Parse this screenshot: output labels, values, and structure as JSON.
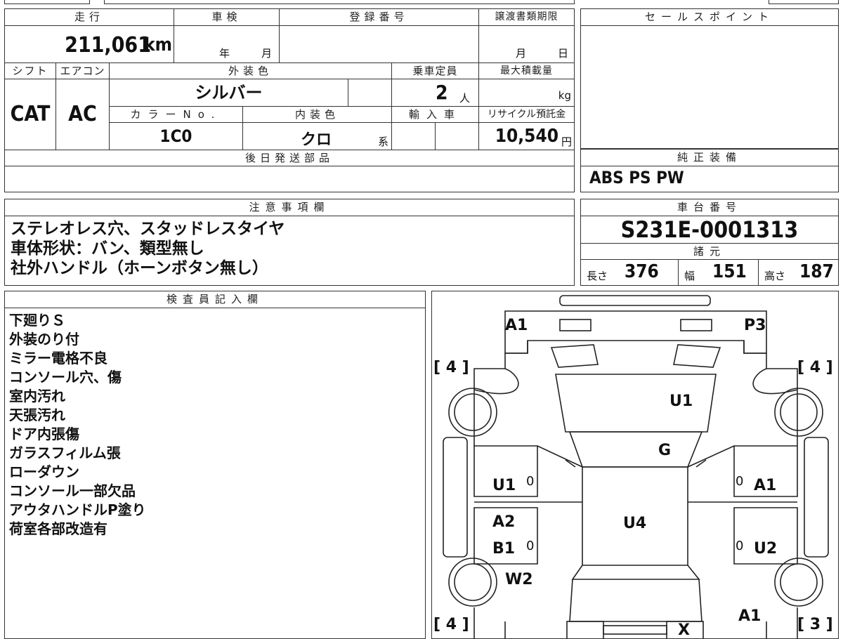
{
  "top_left": {
    "mileage_header": "走行",
    "mileage_value": "211,061",
    "mileage_unit": "km",
    "shaken_header": "車検",
    "shaken_year": "年",
    "shaken_month": "月",
    "reg_header": "登録番号",
    "transfer_header": "譲渡書類期限",
    "transfer_month": "月",
    "transfer_day": "日",
    "shift_header": "シフト",
    "aircon_header": "エアコン",
    "ext_color_header": "外装色",
    "capacity_header": "乗車定員",
    "max_load_header": "最大積載量",
    "shift_value": "CAT",
    "aircon_value": "AC",
    "ext_color_value": "シルバー",
    "capacity_value": "2",
    "capacity_unit": "人",
    "max_load_unit": "kg",
    "color_no_header": "カラーNo.",
    "int_color_header": "内装色",
    "import_header": "輸入車",
    "recycle_header": "リサイクル預託金",
    "color_no_value": "1C0",
    "int_color_value": "クロ",
    "int_color_suffix": "系",
    "recycle_value": "10,540",
    "recycle_unit": "円",
    "later_parts_header": "後日発送部品"
  },
  "sales_point": {
    "header": "セールスポイント"
  },
  "genuine": {
    "header": "純正装備",
    "value": "ABS PS PW"
  },
  "notes": {
    "header": "注意事項欄",
    "lines": [
      "ステレオレス穴、スタッドレスタイヤ",
      "車体形状：バン、類型無し",
      "社外ハンドル（ホーンボタン無し）"
    ]
  },
  "chassis": {
    "header": "車台番号",
    "value": "S231E-0001313"
  },
  "specs": {
    "header": "諸元",
    "length_label": "長さ",
    "length_value": "376",
    "width_label": "幅",
    "width_value": "151",
    "height_label": "高さ",
    "height_value": "187"
  },
  "inspector": {
    "header": "検査員記入欄",
    "lines": [
      "下廻りＳ",
      "外装のり付",
      "ミラー電格不良",
      "コンソール穴、傷",
      "室内汚れ",
      "天張汚れ",
      "ドア内張傷",
      "ガラスフィルム張",
      "ローダウン",
      "コンソール一部欠品",
      "アウタハンドルP塗り",
      "荷室各部改造有"
    ]
  },
  "diagram": {
    "labels": {
      "front_left": "A1",
      "front_right": "P3",
      "tire_fl": "[ 4 ]",
      "tire_fr": "[ 4 ]",
      "tire_rl": "[ 4 ]",
      "tire_rr": "[ 3 ]",
      "hood": "U1",
      "windshield": "G",
      "door_fl": "U1",
      "door_fr": "A1",
      "roof": "U4",
      "door_rl_top": "A2",
      "door_rl_bottom": "B1",
      "door_rr": "U2",
      "rear_left": "W2",
      "rear_right": "A1",
      "rear_center": "X",
      "mirror_l": "0",
      "mirror_r": "0",
      "handle_l": "0",
      "handle_r": "0"
    }
  }
}
